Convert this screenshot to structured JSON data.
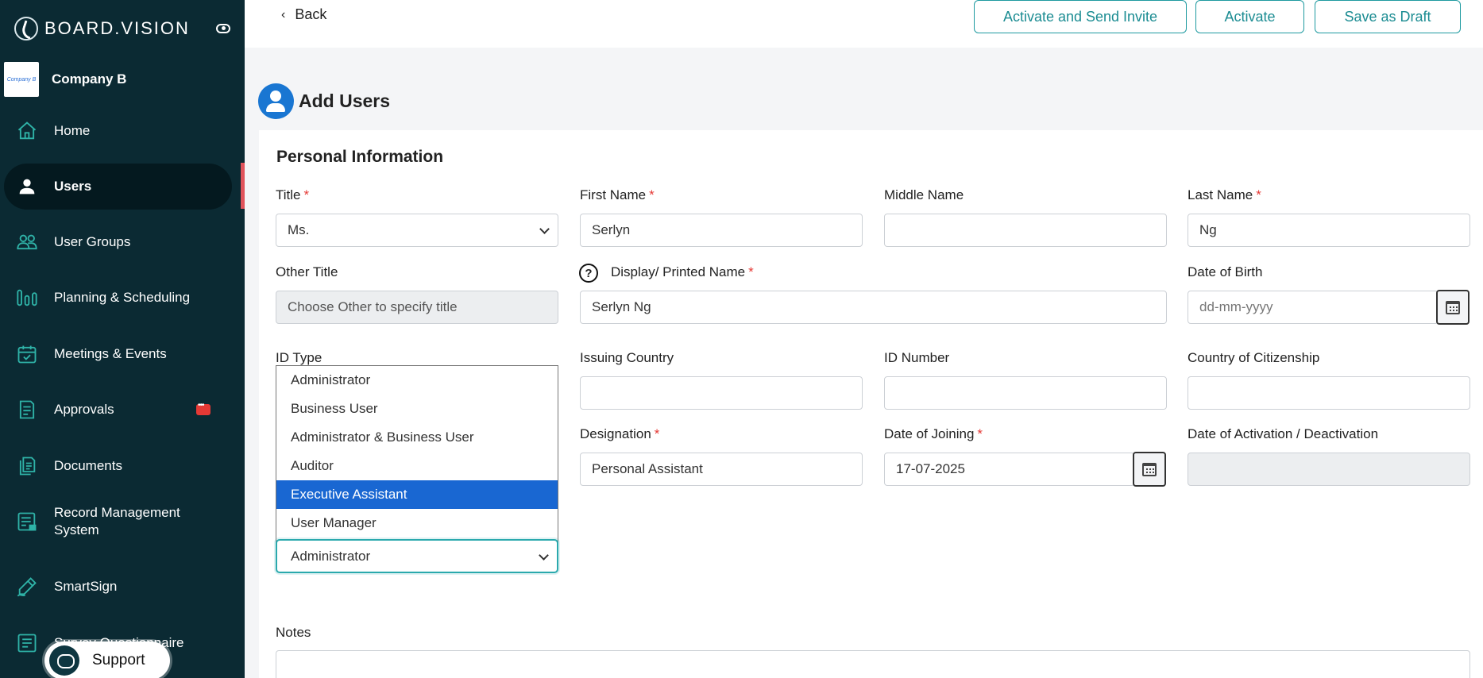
{
  "brand": {
    "name": "BOARD.VISION"
  },
  "company": {
    "logo_text": "Company B",
    "name": "Company B"
  },
  "sidebar": {
    "items": [
      {
        "label": "Home",
        "icon": "home-icon"
      },
      {
        "label": "Users",
        "icon": "user-icon"
      },
      {
        "label": "User Groups",
        "icon": "users-icon"
      },
      {
        "label": "Planning & Scheduling",
        "icon": "bar-chart-icon"
      },
      {
        "label": "Meetings & Events",
        "icon": "calendar-check-icon"
      },
      {
        "label": "Approvals",
        "icon": "clipboard-icon"
      },
      {
        "label": "Documents",
        "icon": "documents-icon"
      },
      {
        "label": "Record Management System",
        "icon": "record-icon"
      },
      {
        "label": "SmartSign",
        "icon": "pen-icon"
      },
      {
        "label": "Survey Questionnaire",
        "icon": "survey-icon"
      }
    ],
    "support_label": "Support"
  },
  "topbar": {
    "back_label": "Back",
    "activate_invite_label": "Activate and Send Invite",
    "activate_label": "Activate",
    "save_draft_label": "Save as Draft"
  },
  "page": {
    "title": "Add Users",
    "section_title": "Personal Information"
  },
  "form": {
    "title": {
      "label": "Title",
      "value": "Ms."
    },
    "first_name": {
      "label": "First Name",
      "value": "Serlyn"
    },
    "middle_name": {
      "label": "Middle Name",
      "value": ""
    },
    "last_name": {
      "label": "Last Name",
      "value": "Ng"
    },
    "other_title": {
      "label": "Other Title",
      "placeholder": "Choose Other to specify title"
    },
    "display_name": {
      "label": "Display/ Printed Name",
      "value": "Serlyn Ng"
    },
    "dob": {
      "label": "Date of Birth",
      "placeholder": "dd-mm-yyyy"
    },
    "id_type": {
      "label": "ID Type"
    },
    "issuing_country": {
      "label": "Issuing Country",
      "value": ""
    },
    "id_number": {
      "label": "ID Number",
      "value": ""
    },
    "citizenship": {
      "label": "Country of Citizenship",
      "value": ""
    },
    "designation": {
      "label": "Designation",
      "value": "Personal Assistant"
    },
    "date_joining": {
      "label": "Date of Joining",
      "value": "17-07-2025"
    },
    "date_activation": {
      "label": "Date of Activation / Deactivation",
      "value": ""
    },
    "notes": {
      "label": "Notes"
    },
    "role_select_value": "Administrator",
    "role_options": [
      "Administrator",
      "Business User",
      "Administrator & Business User",
      "Auditor",
      "Executive Assistant",
      "User Manager"
    ],
    "required_mark": "*"
  },
  "colors": {
    "sidebar_bg": "#0b2a33",
    "accent_teal": "#1e9aa0",
    "selected_blue": "#1967d2",
    "required_red": "#e53935"
  }
}
